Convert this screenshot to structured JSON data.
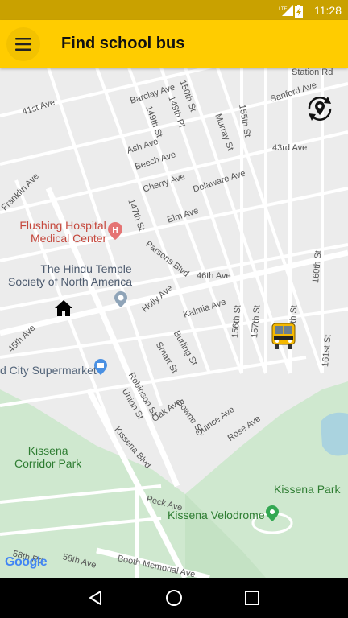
{
  "status_bar": {
    "time": "11:28",
    "network_label": "LTE",
    "icons": [
      "lte-signal-icon",
      "battery-icon"
    ]
  },
  "app_bar": {
    "title": "Find school bus",
    "menu_icon": "hamburger-menu-icon"
  },
  "map": {
    "provider_logo": "Google",
    "colors": {
      "road": "#ffffff",
      "block": "#ececec",
      "park": "#cfe8cf",
      "water": "#aad3df"
    },
    "streets": [
      "Station Rd",
      "Sanford Ave",
      "41st Ave",
      "Barclay Ave",
      "150th St",
      "149th Pl",
      "149th St",
      "Murray St",
      "155th St",
      "43rd Ave",
      "Ash Ave",
      "Beech Ave",
      "Franklin Ave",
      "Cherry Ave",
      "Delaware Ave",
      "147th St",
      "Elm Ave",
      "Parsons Blvd",
      "46th Ave",
      "160th St",
      "Holly Ave",
      "Kalmia Ave",
      "45th Ave",
      "156th St",
      "157th St",
      "159th St",
      "Burling St",
      "Smart St",
      "161st St",
      "Robinson St",
      "Union St",
      "Bowne St",
      "Oak Ave",
      "Quince Ave",
      "Rose Ave",
      "Kissena Blvd",
      "Peck Ave",
      "58th Rd",
      "58th Ave",
      "Booth Memorial Ave"
    ],
    "places": {
      "hospital": [
        "Flushing Hospital",
        "Medical Center"
      ],
      "temple": [
        "The Hindu Temple",
        "Society of North America"
      ],
      "supermarket": "d City Supermarket",
      "corridor_park": [
        "Kissena",
        "Corridor Park"
      ],
      "kissena_park": "Kissena Park",
      "velodrome": "Kissena Velodrome"
    },
    "controls": {
      "recenter_icon": "location-refresh-icon",
      "home_icon": "home-icon",
      "bus_icon": "school-bus-icon"
    }
  },
  "nav_bar": {
    "icons": [
      "back-icon",
      "home-circle-icon",
      "recents-icon"
    ]
  }
}
